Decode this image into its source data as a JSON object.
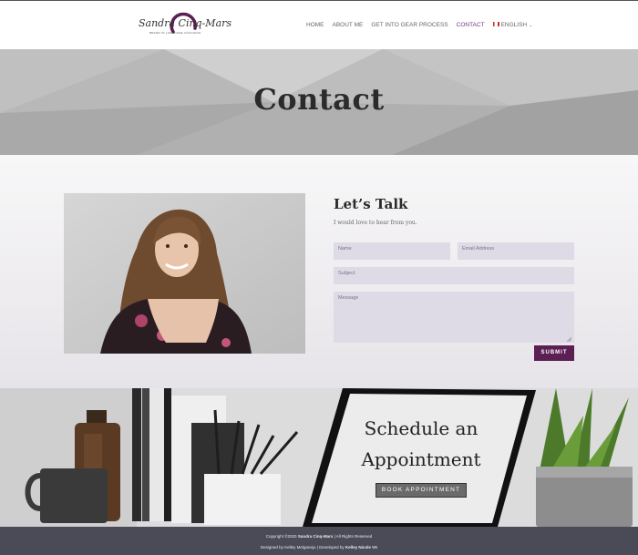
{
  "header": {
    "logo": {
      "script_text": "Sandra Cinq-Mars",
      "tagline": "BRAND IN LANGUAGE COACHING"
    },
    "nav": [
      {
        "label": "HOME"
      },
      {
        "label": "ABOUT ME"
      },
      {
        "label": "GET INTO GEAR PROCESS"
      },
      {
        "label": "CONTACT",
        "active": true
      },
      {
        "label": "ENGLISH",
        "flag": "canada-flag-icon"
      }
    ]
  },
  "hero": {
    "title": "Contact"
  },
  "contact": {
    "title": "Let’s Talk",
    "subtitle": "I would love to hear from you.",
    "fields": {
      "name_placeholder": "Name",
      "email_placeholder": "Email Address",
      "subject_placeholder": "Subject",
      "message_placeholder": "Message"
    },
    "submit_label": "SUBMIT"
  },
  "appointment": {
    "title_line1": "Schedule an",
    "title_line2": "Appointment",
    "button_label": "BOOK APPOINTMENT"
  },
  "footer": {
    "copyright_prefix": "Copyright ©2020",
    "copyright_name": "Sandra Cinq-Mars",
    "copyright_suffix": "| All Rights Reserved",
    "designed_prefix": "Designed by Kelley Melganejo | Developed by",
    "developed_name": "Kelley Nicole VA"
  },
  "colors": {
    "accent": "#5b1f54",
    "nav_active": "#6a3d7a",
    "field_bg": "#dedae6",
    "footer_bg": "#4a4b56"
  }
}
